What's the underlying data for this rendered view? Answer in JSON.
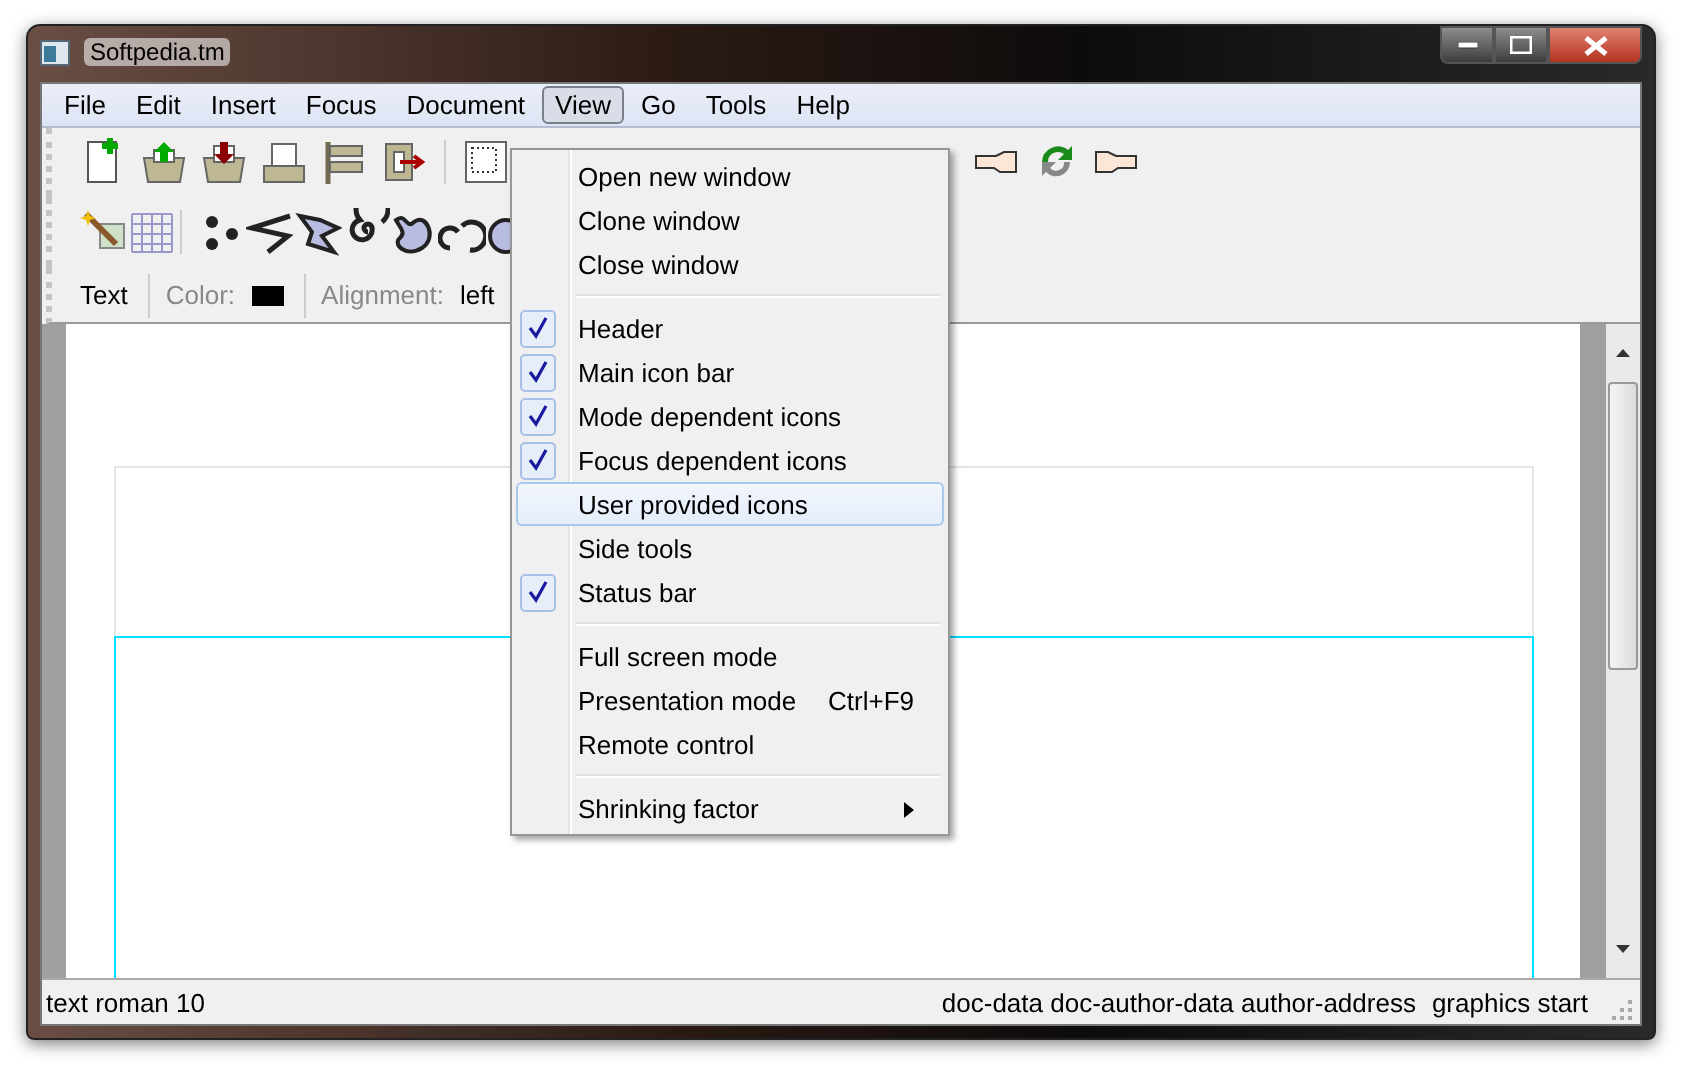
{
  "window": {
    "title": "Softpedia.tm"
  },
  "menu_bar": [
    {
      "label": "File",
      "selected": false
    },
    {
      "label": "Edit",
      "selected": false
    },
    {
      "label": "Insert",
      "selected": false
    },
    {
      "label": "Focus",
      "selected": false
    },
    {
      "label": "Document",
      "selected": false
    },
    {
      "label": "View",
      "selected": true
    },
    {
      "label": "Go",
      "selected": false
    },
    {
      "label": "Tools",
      "selected": false
    },
    {
      "label": "Help",
      "selected": false
    }
  ],
  "view_menu": [
    {
      "kind": "item",
      "label": "Open new window",
      "checked": false,
      "selected": false
    },
    {
      "kind": "item",
      "label": "Clone window",
      "checked": false,
      "selected": false
    },
    {
      "kind": "item",
      "label": "Close window",
      "checked": false,
      "selected": false
    },
    {
      "kind": "separator"
    },
    {
      "kind": "item",
      "label": "Header",
      "checked": true,
      "selected": false
    },
    {
      "kind": "item",
      "label": "Main icon bar",
      "checked": true,
      "selected": false
    },
    {
      "kind": "item",
      "label": "Mode dependent icons",
      "checked": true,
      "selected": false
    },
    {
      "kind": "item",
      "label": "Focus dependent icons",
      "checked": true,
      "selected": false
    },
    {
      "kind": "item",
      "label": "User provided icons",
      "checked": false,
      "selected": true
    },
    {
      "kind": "item",
      "label": "Side tools",
      "checked": false,
      "selected": false
    },
    {
      "kind": "item",
      "label": "Status bar",
      "checked": true,
      "selected": false
    },
    {
      "kind": "separator"
    },
    {
      "kind": "item",
      "label": "Full screen mode",
      "checked": false,
      "selected": false
    },
    {
      "kind": "item",
      "label": "Presentation mode",
      "shortcut": "Ctrl+F9",
      "checked": false,
      "selected": false
    },
    {
      "kind": "item",
      "label": "Remote control",
      "checked": false,
      "selected": false
    },
    {
      "kind": "separator"
    },
    {
      "kind": "submenu",
      "label": "Shrinking factor",
      "checked": false,
      "selected": false
    }
  ],
  "format_bar": {
    "mode": "Text",
    "color_label": "Color:",
    "alignment_label": "Alignment:",
    "alignment": "left"
  },
  "status_bar": {
    "left": "text roman 10",
    "right": [
      "doc-data doc-author-data author-address",
      "graphics start"
    ]
  }
}
